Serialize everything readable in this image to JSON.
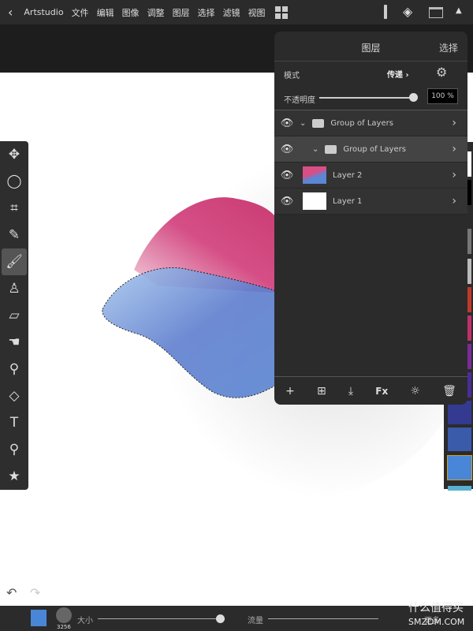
{
  "topbar": {
    "app": "Artstudio",
    "menus": [
      "文件",
      "编辑",
      "图像",
      "调整",
      "图层",
      "选择",
      "滤镜",
      "视图"
    ]
  },
  "layers_panel": {
    "title": "图层",
    "select": "选择",
    "mode_label": "模式",
    "mode_value": "传递",
    "opacity_label": "不透明度",
    "opacity_value": "100 %",
    "opacity": 100,
    "layers": [
      {
        "name": "Group of Layers",
        "type": "group",
        "indent": 0
      },
      {
        "name": "Group of Layers",
        "type": "group",
        "indent": 1,
        "selected": true
      },
      {
        "name": "Layer 2",
        "type": "layer"
      },
      {
        "name": "Layer 1",
        "type": "layer"
      }
    ],
    "footer": [
      "add-icon",
      "add-group-icon",
      "import-icon",
      "Fx",
      "adjust-icon",
      "trash-icon"
    ]
  },
  "tools": [
    "move",
    "lasso",
    "crop",
    "eyedropper",
    "brush",
    "stamp",
    "eraser",
    "smudge",
    "dodge",
    "fill",
    "text",
    "zoom",
    "star"
  ],
  "bottom": {
    "size_label": "大小",
    "brush_size": "3256",
    "flow_label": "流量",
    "more": "更多",
    "color": "#4a86d8",
    "size_value": 0.85
  },
  "palette": [
    "#ffffff",
    "#000000",
    "#777777",
    "#bbbbbb",
    "#c0392b",
    "#c0306a",
    "#7b2a9a",
    "#4a2d9a",
    "#333a90",
    "#3a5aaa",
    "#4a86d8",
    "#5ab0d0"
  ],
  "watermark": {
    "cn": "什么值得买",
    "en": "SMZDM.COM"
  }
}
